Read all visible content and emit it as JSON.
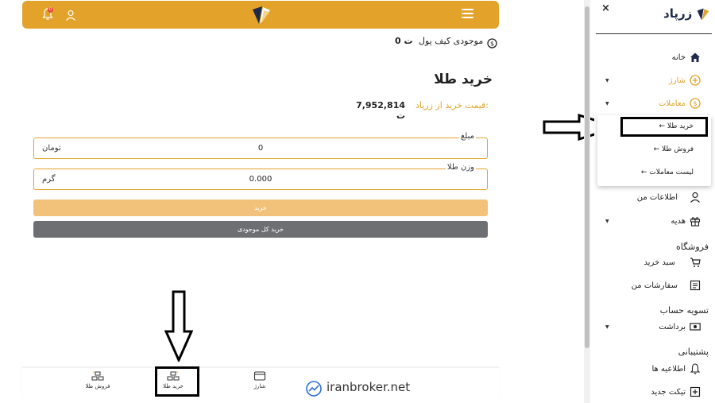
{
  "header": {
    "notification_count": "0",
    "brand_color": "#e3a32a"
  },
  "wallet": {
    "label": "موجودی کیف پول",
    "amount": "0 ت"
  },
  "page": {
    "title": "خرید طلا",
    "price_label": "قیمت خرید از زرپاد:",
    "price_value": "7,952,814 ت"
  },
  "form": {
    "amount_label": "مبلغ",
    "amount_value": "0",
    "amount_unit": "تومان",
    "weight_label": "وزن طلا",
    "weight_value": "0.000",
    "weight_unit": "گرم",
    "buy_button": "خرید",
    "buy_all_button": "خرید کل موجودی"
  },
  "bottom_nav": {
    "sell_label": "فروش طلا",
    "buy_label": "خرید طلا",
    "charge_label": "شارژ"
  },
  "watermark": {
    "text": "iranbroker.net"
  },
  "sidebar": {
    "brand": "زرپاد",
    "close": "×",
    "home": "خانه",
    "charge": "شارژ",
    "transactions": "معاملات",
    "sub_buy": "خرید طلا",
    "sub_sell": "فروش طلا",
    "sub_list": "لیست معاملات",
    "my_info": "اطلاعات من",
    "gift": "هدیه",
    "shop_section": "فروشگاه",
    "cart": "سبد خرید",
    "orders": "سفارشات من",
    "settlement_section": "تسویه حساب",
    "withdraw": "برداشت",
    "support_section": "پشتیبانی",
    "announcements": "اطلاعیه ها",
    "new_ticket": "تیکت جدید"
  }
}
